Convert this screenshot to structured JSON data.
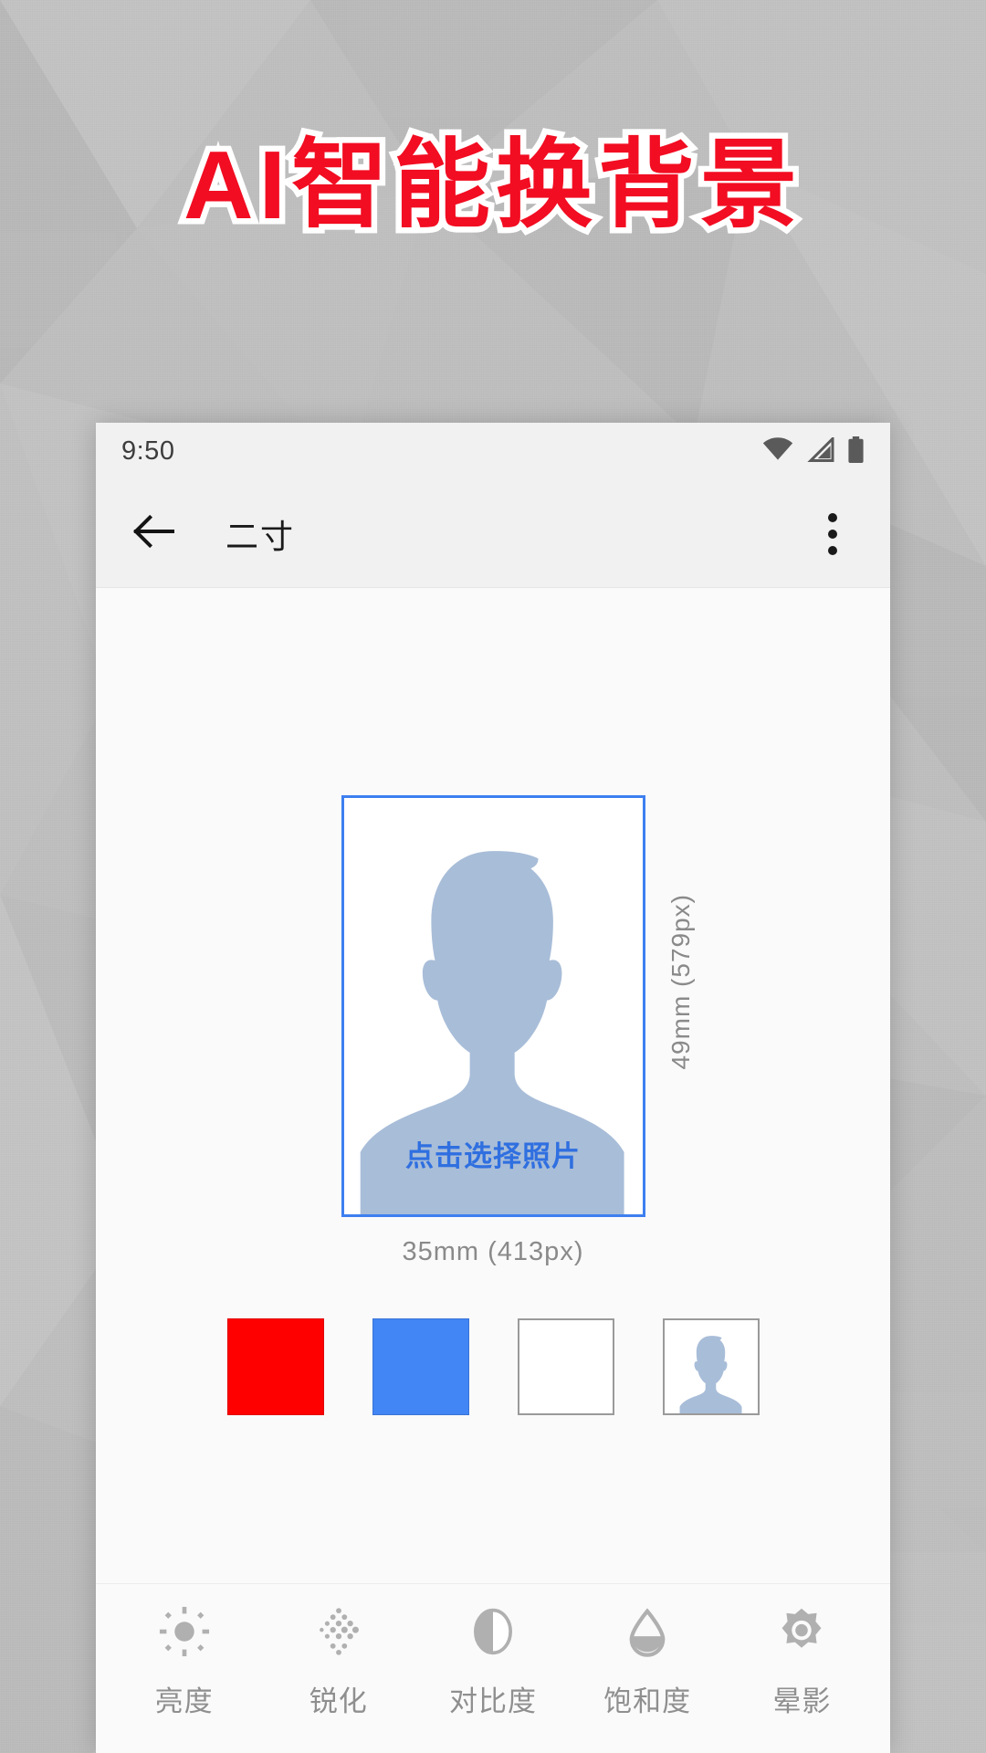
{
  "promo": {
    "headline": "AI智能换背景"
  },
  "phone": {
    "status_bar": {
      "clock": "9:50",
      "icons": [
        "wifi-icon",
        "cellular-signal-icon",
        "battery-icon"
      ]
    },
    "app_bar": {
      "back_icon": "back-arrow-icon",
      "title": "二寸",
      "overflow_icon": "overflow-menu-icon"
    },
    "photo": {
      "placeholder_label": "点击选择照片",
      "width_label": "35mm (413px)",
      "height_label": "49mm (579px)",
      "frame_border_color": "#3d7ff0",
      "silhouette_color": "#a8bdd8"
    },
    "swatches": [
      {
        "name": "red",
        "color": "#ff0000",
        "style": "plain"
      },
      {
        "name": "blue",
        "color": "#4285f4",
        "style": "plain"
      },
      {
        "name": "white",
        "color": "#ffffff",
        "style": "bordered"
      },
      {
        "name": "original-photo",
        "color": "#ffffff",
        "style": "thumb"
      }
    ],
    "tools": [
      {
        "icon": "brightness-icon",
        "label": "亮度"
      },
      {
        "icon": "sharpen-icon",
        "label": "锐化"
      },
      {
        "icon": "contrast-icon",
        "label": "对比度"
      },
      {
        "icon": "saturation-icon",
        "label": "饱和度"
      },
      {
        "icon": "vignette-icon",
        "label": "晕影"
      }
    ]
  },
  "colors": {
    "headline_red": "#f20d22",
    "headline_outline": "#ffffff",
    "backdrop_gray": "#bdbdbd",
    "accent_blue": "#3d7ff0",
    "tool_gray": "#b0b0b0"
  }
}
